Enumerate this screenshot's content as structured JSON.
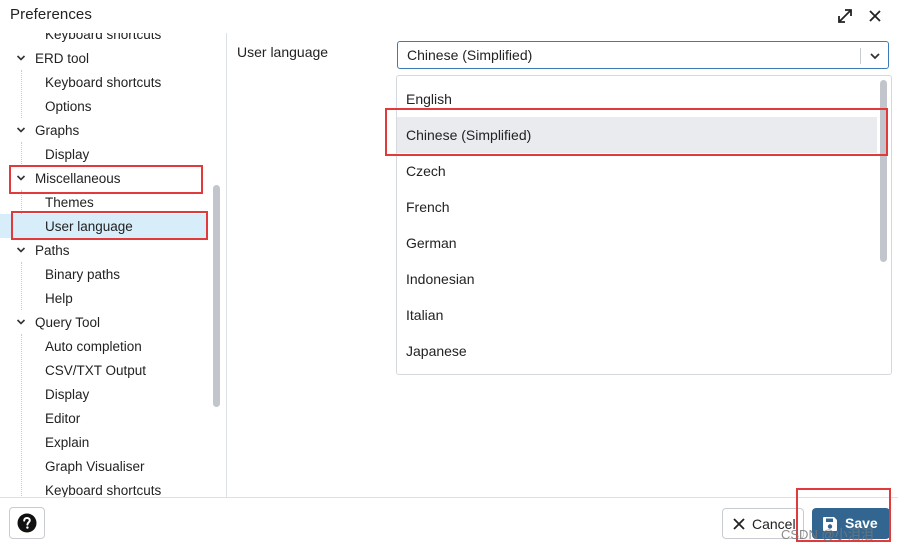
{
  "window": {
    "title": "Preferences"
  },
  "sidebar": {
    "items": [
      {
        "label": "Keyboard shortcuts",
        "type": "child"
      },
      {
        "label": "ERD tool",
        "type": "parent"
      },
      {
        "label": "Keyboard shortcuts",
        "type": "child"
      },
      {
        "label": "Options",
        "type": "child"
      },
      {
        "label": "Graphs",
        "type": "parent"
      },
      {
        "label": "Display",
        "type": "child"
      },
      {
        "label": "Miscellaneous",
        "type": "parent"
      },
      {
        "label": "Themes",
        "type": "child"
      },
      {
        "label": "User language",
        "type": "child",
        "selected": true
      },
      {
        "label": "Paths",
        "type": "parent"
      },
      {
        "label": "Binary paths",
        "type": "child"
      },
      {
        "label": "Help",
        "type": "child"
      },
      {
        "label": "Query Tool",
        "type": "parent"
      },
      {
        "label": "Auto completion",
        "type": "child"
      },
      {
        "label": "CSV/TXT Output",
        "type": "child"
      },
      {
        "label": "Display",
        "type": "child"
      },
      {
        "label": "Editor",
        "type": "child"
      },
      {
        "label": "Explain",
        "type": "child"
      },
      {
        "label": "Graph Visualiser",
        "type": "child"
      },
      {
        "label": "Keyboard shortcuts",
        "type": "child"
      }
    ]
  },
  "main": {
    "field_label": "User language",
    "select": {
      "value": "Chinese (Simplified)",
      "options": [
        "English",
        "Chinese (Simplified)",
        "Czech",
        "French",
        "German",
        "Indonesian",
        "Italian",
        "Japanese"
      ],
      "selected_index": 1
    }
  },
  "footer": {
    "cancel_label": "Cancel",
    "save_label": "Save"
  },
  "watermark": "CSDN @小泪泪",
  "colors": {
    "accent": "#326690",
    "selected_bg": "#d7edfa",
    "option_selected_bg": "#e9ebef",
    "highlight_border": "#e03a3a"
  }
}
